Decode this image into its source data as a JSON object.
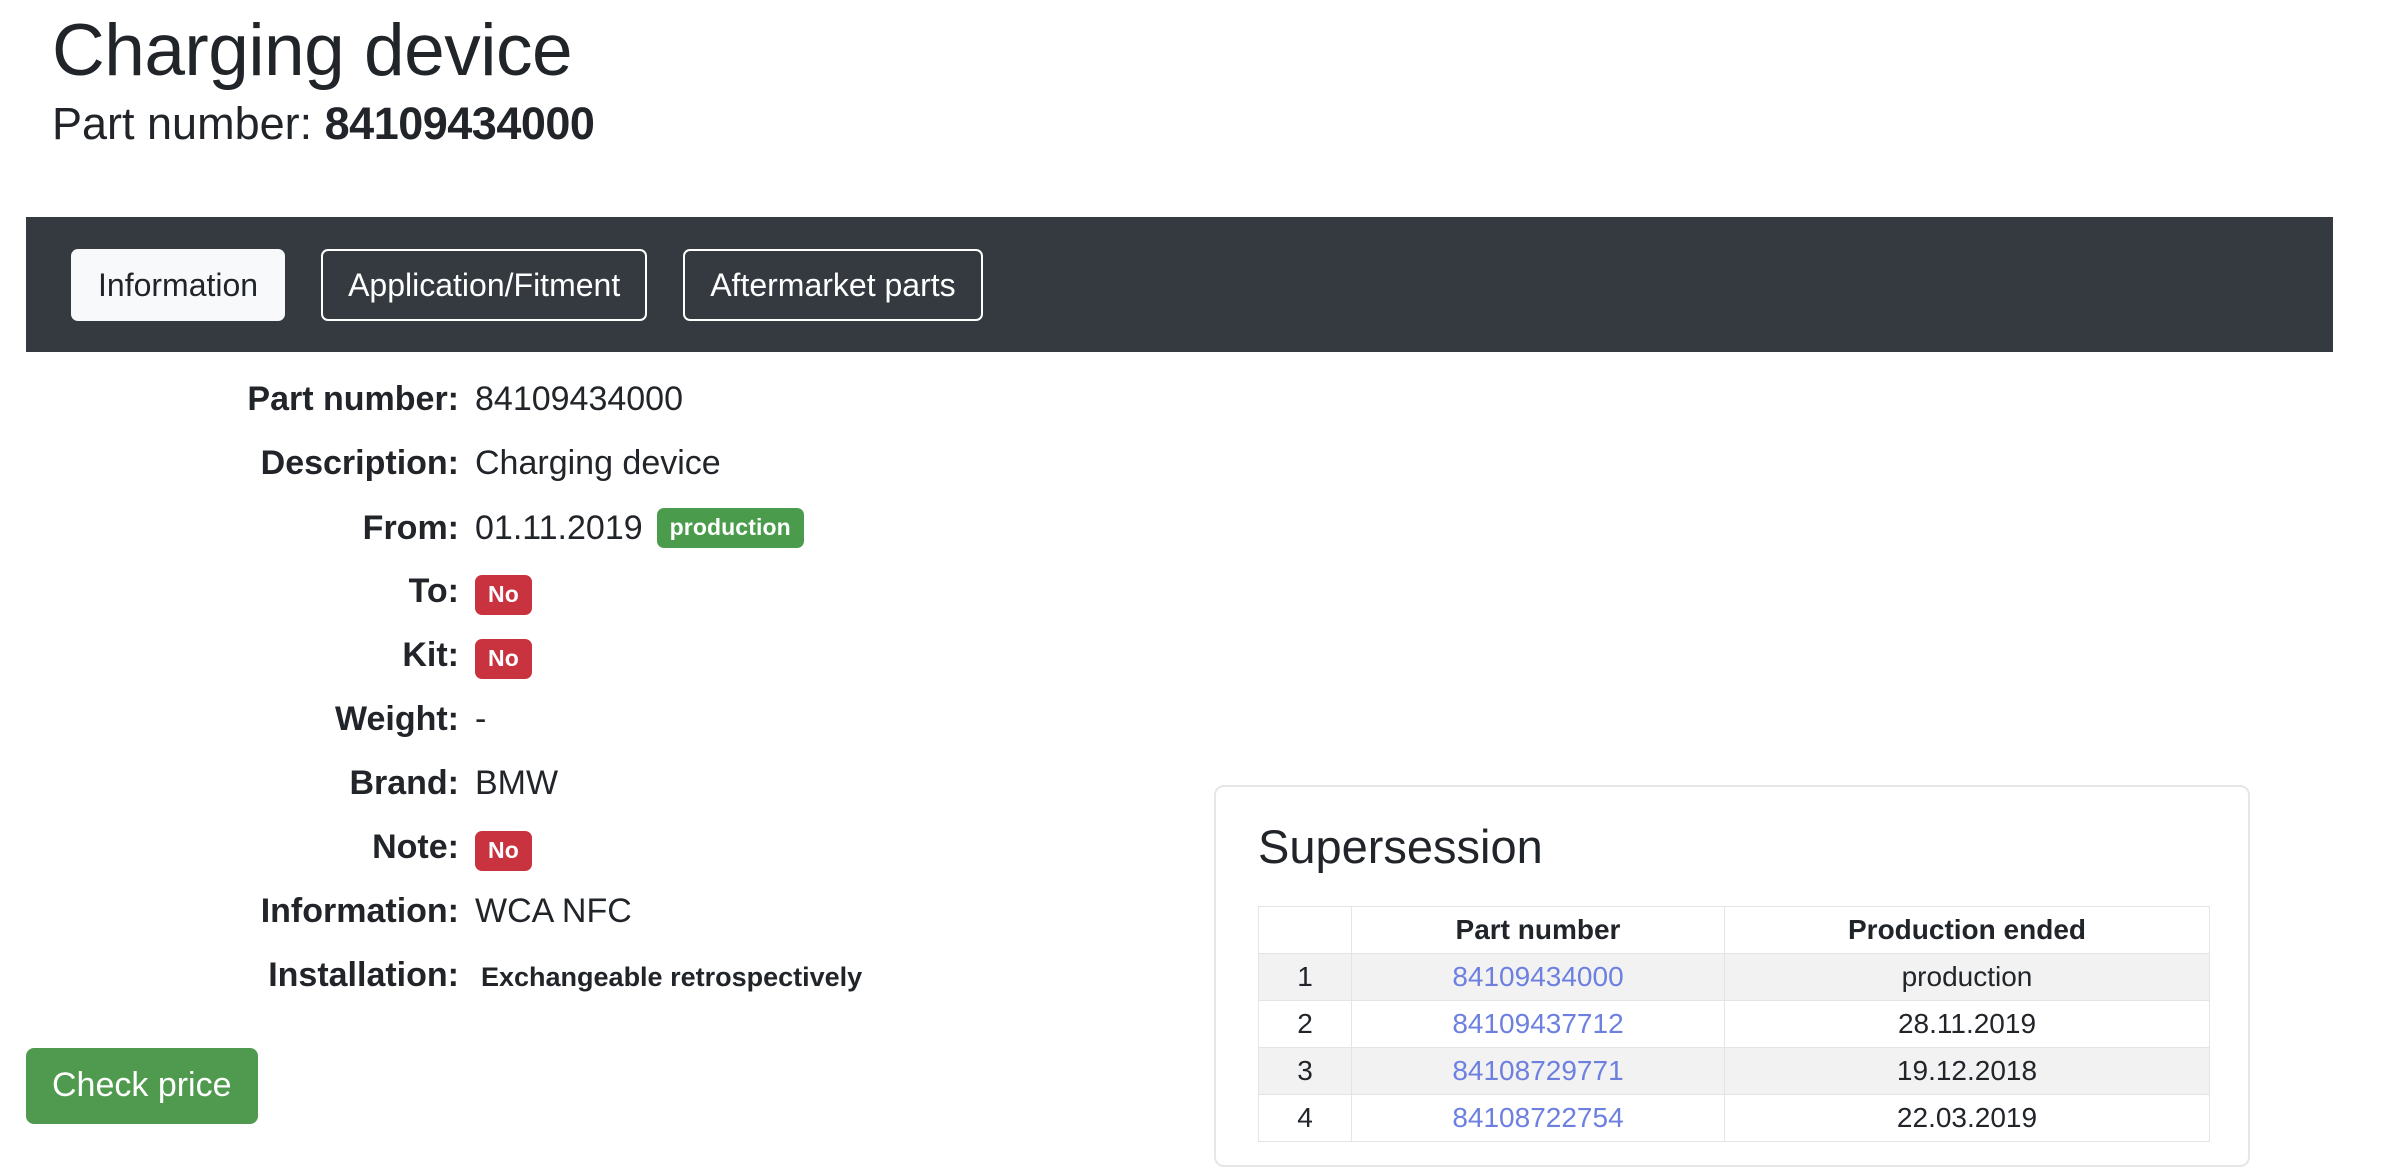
{
  "header": {
    "title": "Charging device",
    "part_label": "Part number:",
    "part_value": "84109434000"
  },
  "tabs": [
    {
      "label": "Information",
      "state": "active"
    },
    {
      "label": "Application/Fitment",
      "state": "outline"
    },
    {
      "label": "Aftermarket parts",
      "state": "outline"
    }
  ],
  "specs": [
    {
      "label": "Part number:",
      "value": "84109434000"
    },
    {
      "label": "Description:",
      "value": "Charging device"
    },
    {
      "label": "From:",
      "value": "01.11.2019",
      "badge": "production",
      "badge_kind": "success"
    },
    {
      "label": "To:",
      "value": "",
      "badge": "No",
      "badge_kind": "danger"
    },
    {
      "label": "Kit:",
      "value": "",
      "badge": "No",
      "badge_kind": "danger"
    },
    {
      "label": "Weight:",
      "value": "-"
    },
    {
      "label": "Brand:",
      "value": "BMW"
    },
    {
      "label": "Note:",
      "value": "",
      "badge": "No",
      "badge_kind": "danger"
    },
    {
      "label": "Information:",
      "value": "WCA NFC"
    },
    {
      "label": "Installation:",
      "value": "Exchangeable retrospectively"
    }
  ],
  "check_price_label": "Check price",
  "supersession": {
    "title": "Supersession",
    "columns": [
      "",
      "Part number",
      "Production ended"
    ],
    "rows": [
      {
        "index": "1",
        "part_number": "84109434000",
        "production_ended": "production"
      },
      {
        "index": "2",
        "part_number": "84109437712",
        "production_ended": "28.11.2019"
      },
      {
        "index": "3",
        "part_number": "84108729771",
        "production_ended": "19.12.2018"
      },
      {
        "index": "4",
        "part_number": "84108722754",
        "production_ended": "22.03.2019"
      }
    ]
  },
  "colors": {
    "navbar_bg": "#343a40",
    "badge_success": "#4a9c4c",
    "badge_danger": "#c9323f",
    "button_success": "#4f9a4f",
    "link": "#6d80e0"
  }
}
